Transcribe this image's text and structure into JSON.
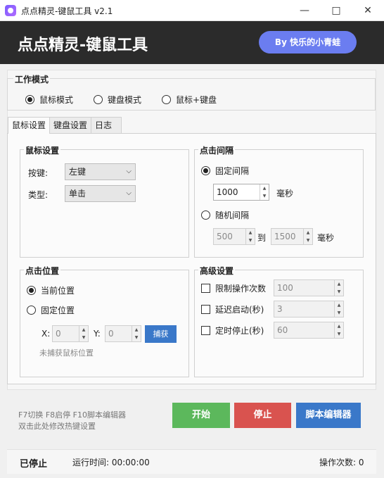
{
  "window": {
    "title": "点点精灵-键鼠工具 v2.1"
  },
  "banner": {
    "title": "点点精灵-键鼠工具",
    "author": "By 快乐的小青蛙"
  },
  "mode": {
    "legend": "工作模式",
    "options": [
      "鼠标模式",
      "键盘模式",
      "鼠标+键盘"
    ],
    "selected": "鼠标模式"
  },
  "tabs": [
    "鼠标设置",
    "键盘设置",
    "日志"
  ],
  "mouse_settings": {
    "legend": "鼠标设置",
    "button_label": "按键:",
    "button_value": "左键",
    "type_label": "类型:",
    "type_value": "单击"
  },
  "click_interval": {
    "legend": "点击间隔",
    "fixed_label": "固定间隔",
    "fixed_value": "1000",
    "fixed_unit": "毫秒",
    "random_label": "随机间隔",
    "random_min": "500",
    "random_to": "到",
    "random_max": "1500",
    "random_unit": "毫秒",
    "selected": "固定间隔"
  },
  "click_position": {
    "legend": "点击位置",
    "current_label": "当前位置",
    "fixed_label": "固定位置",
    "selected": "当前位置",
    "x_label": "X:",
    "x_value": "0",
    "y_label": "Y:",
    "y_value": "0",
    "capture_label": "捕获",
    "hint": "未捕获鼠标位置"
  },
  "advanced": {
    "legend": "高级设置",
    "limit_label": "限制操作次数",
    "limit_value": "100",
    "delay_label": "延迟启动(秒)",
    "delay_value": "3",
    "stop_label": "定时停止(秒)",
    "stop_value": "60"
  },
  "hotkeys": {
    "line1": "F7切换 F8启停 F10脚本编辑器",
    "line2": "双击此处修改热键设置"
  },
  "actions": {
    "start": "开始",
    "stop": "停止",
    "script_editor": "脚本编辑器"
  },
  "status": {
    "state": "已停止",
    "runtime": "运行时间: 00:00:00",
    "ops": "操作次数: 0"
  },
  "colors": {
    "banner": "#2b2b2b",
    "pill": "#6b7df0",
    "start": "#5cb85c",
    "stop": "#d9534f",
    "editor": "#3a78c9"
  }
}
